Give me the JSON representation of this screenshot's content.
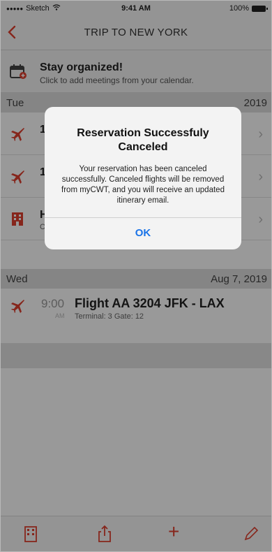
{
  "status_bar": {
    "carrier": "Sketch",
    "time": "9:41 AM",
    "battery": "100%"
  },
  "nav": {
    "title": "TRIP TO NEW YORK"
  },
  "banner": {
    "title": "Stay organized!",
    "subtitle": "Click to add meetings from your calendar."
  },
  "days": [
    {
      "day": "Tue",
      "date": "2019"
    },
    {
      "day": "Wed",
      "date": "Aug 7, 2019"
    }
  ],
  "rows": [
    {
      "frag": "1",
      "frag2": ""
    },
    {
      "frag": "1",
      "frag2": ""
    },
    {
      "frag": "H",
      "frag2": "C"
    }
  ],
  "flight": {
    "time": "9:00",
    "ampm": "AM",
    "title": "Flight AA 3204 JFK - LAX",
    "meta": "Terminal: 3   Gate: 12"
  },
  "alert": {
    "title": "Reservation Successfuly Canceled",
    "message": "Your reservation has been canceled successfully. Canceled flights will be removed from myCWT, and you will receive an updated itinerary email.",
    "ok": "OK"
  },
  "icons": {
    "back": "chevron-left-icon",
    "calendar": "calendar-icon",
    "plane": "plane-icon",
    "hotel": "hotel-icon",
    "share": "share-icon",
    "add": "plus-icon",
    "edit": "pencil-icon"
  },
  "colors": {
    "accent": "#e0402f",
    "link": "#1a73e8"
  }
}
